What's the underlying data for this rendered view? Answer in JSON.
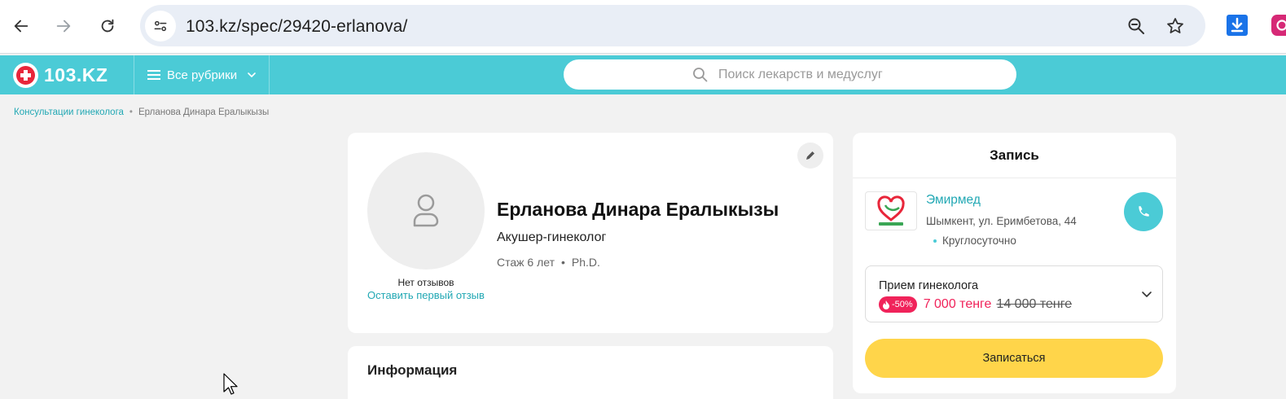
{
  "browser": {
    "url": "103.kz/spec/29420-erlanova/",
    "icons": [
      "back-arrow-icon",
      "forward-arrow-icon",
      "reload-icon",
      "site-info-icon",
      "zoom-icon",
      "star-icon",
      "download-icon",
      "instagram-icon"
    ]
  },
  "header": {
    "logo_text": "103.KZ",
    "rubrics_label": "Все рубрики",
    "search_placeholder": "Поиск лекарств и медуслуг",
    "brand_color": "#4bcbd6",
    "logo_red": "#e8263a"
  },
  "breadcrumb": {
    "items": [
      "Консультации гинеколога",
      "Ерланова Динара Ералыкызы"
    ]
  },
  "doctor": {
    "name": "Ерланова Динара Ералыкызы",
    "specialty": "Акушер-гинеколог",
    "experience": "Стаж 6 лет",
    "degree": "Ph.D.",
    "no_reviews": "Нет отзывов",
    "leave_review": "Оставить первый отзыв"
  },
  "info": {
    "title": "Информация"
  },
  "booking": {
    "title": "Запись",
    "clinic_name": "Эмирмед",
    "clinic_address": "Шымкент, ул. Еримбетова, 44",
    "clinic_hours": "Круглосуточно",
    "service_name": "Прием гинеколога",
    "discount": "-50%",
    "price_new": "7 000 тенге",
    "price_old": "14 000 тенге",
    "book_label": "Записаться",
    "price_color": "#f0235a",
    "button_color": "#ffd54a"
  }
}
